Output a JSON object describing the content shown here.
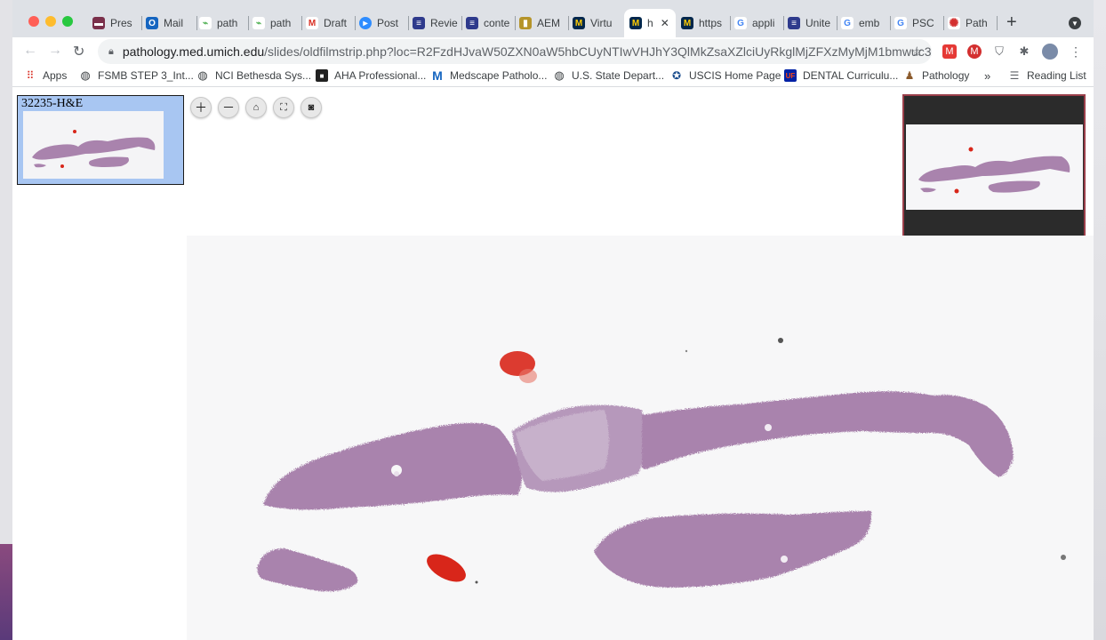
{
  "tabs": [
    {
      "label": "Pres",
      "icon": "slides-icon",
      "color": "#c0392b"
    },
    {
      "label": "Mail",
      "icon": "outlook-icon",
      "color": "#1565c0"
    },
    {
      "label": "path",
      "icon": "microscope-icon",
      "color": "#4caf50"
    },
    {
      "label": "path",
      "icon": "microscope-icon",
      "color": "#4caf50"
    },
    {
      "label": "Draft",
      "icon": "gmail-icon",
      "color": "#d93025"
    },
    {
      "label": "Post",
      "icon": "zoom-icon",
      "color": "#2d8cff"
    },
    {
      "label": "Revie",
      "icon": "journal-icon",
      "color": "#2e3a8c"
    },
    {
      "label": "conte",
      "icon": "journal-icon",
      "color": "#2e3a8c"
    },
    {
      "label": "AEM",
      "icon": "book-icon",
      "color": "#b5942a"
    },
    {
      "label": "Virtu",
      "icon": "umich-icon",
      "color": "#00274c"
    },
    {
      "label": "h",
      "icon": "umich-icon",
      "color": "#00274c"
    },
    {
      "label": "https",
      "icon": "umich-icon",
      "color": "#00274c"
    },
    {
      "label": "appli",
      "icon": "google-icon",
      "color": "#4285f4"
    },
    {
      "label": "Unite",
      "icon": "journal-icon",
      "color": "#2e3a8c"
    },
    {
      "label": "emb",
      "icon": "google-icon",
      "color": "#4285f4"
    },
    {
      "label": "PSC",
      "icon": "google-icon",
      "color": "#4285f4"
    },
    {
      "label": "Path",
      "icon": "gear-icon",
      "color": "#d32f2f"
    }
  ],
  "url": {
    "domain": "pathology.med.umich.edu",
    "path": "/slides/oldfilmstrip.php?loc=R2FzdHJvaW50ZXN0aW5hbCUyNTIwVHJhY3QlMkZsaXZlciUyRkglMjZFXzMyMjM1bmwuc3Z..."
  },
  "bookmarks": [
    {
      "label": "Apps",
      "icon": "apps-grid-icon"
    },
    {
      "label": "FSMB STEP 3_Int...",
      "icon": "globe-icon"
    },
    {
      "label": "NCI Bethesda Sys...",
      "icon": "globe-icon"
    },
    {
      "label": "AHA Professional...",
      "icon": "aha-icon"
    },
    {
      "label": "Medscape Patholo...",
      "icon": "medscape-icon"
    },
    {
      "label": "U.S. State Depart...",
      "icon": "globe-icon"
    },
    {
      "label": "USCIS Home Page",
      "icon": "seal-icon"
    },
    {
      "label": "DENTAL Curriculu...",
      "icon": "uf-icon"
    },
    {
      "label": "Pathology",
      "icon": "person-icon"
    }
  ],
  "bookmarks_overflow": "»",
  "reading_list": "Reading List",
  "filmstrip": {
    "title": "32235-H&E"
  },
  "viewer_controls": [
    "zoom-in",
    "zoom-out",
    "home",
    "fullscreen",
    "screenshot"
  ],
  "colors": {
    "tissue": "#a983ad",
    "tissue_dark": "#8b5f8f",
    "blood": "#d8261a",
    "filmstrip_selected": "#a8c6f2",
    "navigator_border": "#9b3f4a"
  }
}
